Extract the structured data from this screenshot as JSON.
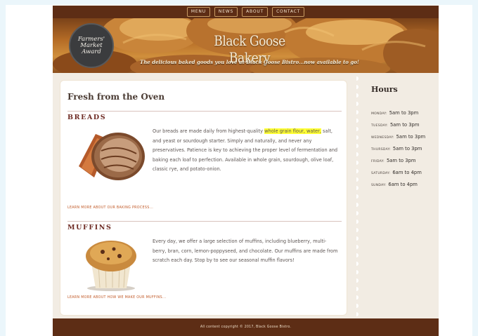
{
  "nav": {
    "items": [
      {
        "label": "MENU"
      },
      {
        "label": "NEWS"
      },
      {
        "label": "ABOUT"
      },
      {
        "label": "CONTACT"
      }
    ]
  },
  "header": {
    "badge_lines": [
      "Farmers'",
      "Market",
      "Award"
    ],
    "site_title": "Black Goose Bakery",
    "tagline": "The delicious baked goods you love at Black Goose Bistro...now available to go!"
  },
  "main": {
    "title": "Fresh from the Oven",
    "sections": [
      {
        "heading": "BREADS",
        "text_before": "Our breads are made daily from highest-quality ",
        "highlight": "whole grain flour, water,",
        "text_after": " salt, and yeast or sourdough starter. Simply and naturally, and never any preservatives. Patience is key to achieving the proper level of fermentation and baking each loaf to perfection. Available in whole grain, sourdough, olive loaf, classic rye, and potato-onion.",
        "learn_more": "LEARN MORE ABOUT OUR BAKING PROCESS..."
      },
      {
        "heading": "MUFFINS",
        "text": "Every day, we offer a large selection of muffins, including blueberry, multi-berry, bran, corn, lemon-poppyseed, and chocolate. Our muffins are made from scratch each day. Stop by to see our seasonal muffin flavors!",
        "learn_more": "LEARN MORE ABOUT HOW WE MAKE OUR MUFFINS..."
      }
    ]
  },
  "sidebar": {
    "title": "Hours",
    "hours": [
      {
        "day": "Monday:",
        "time": "5am to 3pm"
      },
      {
        "day": "Tuesday:",
        "time": "5am to 3pm"
      },
      {
        "day": "Wednesday:",
        "time": "5am to 3pm"
      },
      {
        "day": "Thursday:",
        "time": "5am to 3pm"
      },
      {
        "day": "Friday:",
        "time": "5am to 3pm"
      },
      {
        "day": "Saturday:",
        "time": "6am to 4pm"
      },
      {
        "day": "Sunday:",
        "time": "6am to 4pm"
      }
    ]
  },
  "footer": {
    "text": "All content copyright © 2017, Black Goose Bistro."
  },
  "colors": {
    "nav_bg": "#5d2d15",
    "accent": "#6e2b24",
    "link": "#c15a28",
    "highlight": "#ffff33"
  }
}
